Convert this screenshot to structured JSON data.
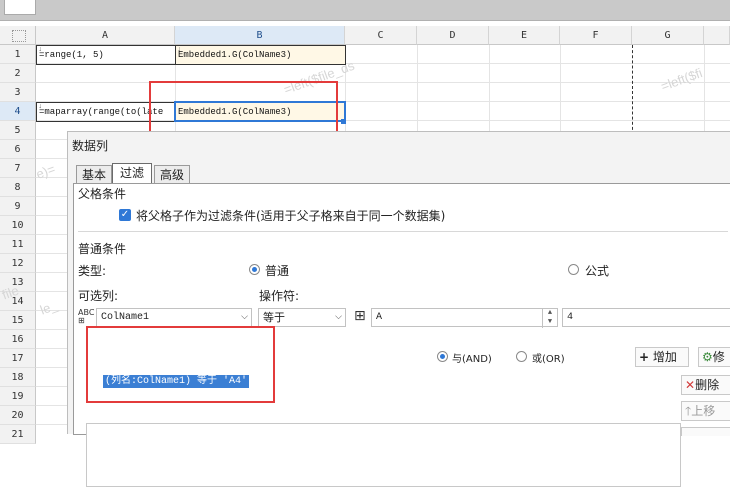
{
  "sheet": {
    "columns": [
      "A",
      "B",
      "C",
      "D",
      "E",
      "F",
      "G"
    ],
    "rows": [
      "1",
      "2",
      "3",
      "4",
      "5",
      "6",
      "7",
      "8",
      "9",
      "10",
      "11",
      "12",
      "13",
      "14",
      "15",
      "16",
      "17",
      "18",
      "19",
      "20",
      "21"
    ],
    "cells": {
      "a1": "=range(1, 5)",
      "b1": "Embedded1.G(ColName3)",
      "a4": "=maparray(range(to(late",
      "b4": "Embedded1.G(ColName3)"
    },
    "watermarks": [
      "=left($file_ds",
      "=left($fi",
      "file",
      "e)=",
      "le_"
    ]
  },
  "dialog": {
    "title": "数据列",
    "tabs": [
      "基本",
      "过滤",
      "高级"
    ],
    "parent_section": "父格条件",
    "parent_checkbox": "将父格子作为过滤条件(适用于父子格来自于同一个数据集)",
    "normal_section": "普通条件",
    "type_label": "类型:",
    "type_options": [
      "普通",
      "公式"
    ],
    "column_label": "可选列:",
    "operator_label": "操作符:",
    "column_value": "ColName1",
    "operator_value": "等于",
    "value_type": "A",
    "value_input": "4",
    "logic_options": [
      "与(AND)",
      "或(OR)"
    ],
    "add_button": "增加",
    "modify_button": "修",
    "delete_button": "删除",
    "up_button": "上移",
    "condition_item": "(列名:ColName1) 等于 'A4'"
  },
  "colors": {
    "accent": "#2f78d6",
    "annotation_red": "#e33b3b",
    "selection": "#3b7fd4"
  }
}
